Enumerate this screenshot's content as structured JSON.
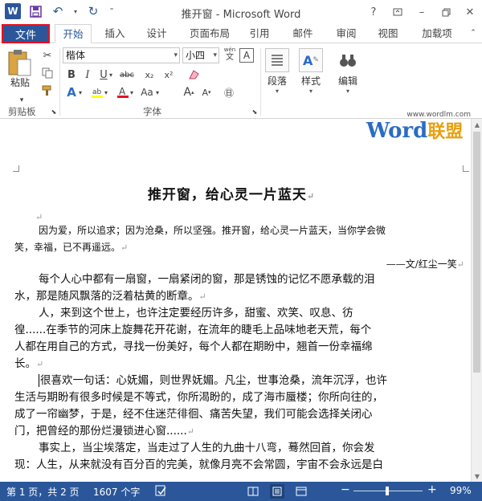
{
  "window": {
    "title": "推开窗 - Microsoft Word",
    "help": "?",
    "logo_letter": "W"
  },
  "tabs": {
    "file": "文件",
    "items": [
      "开始",
      "插入",
      "设计",
      "页面布局",
      "引用",
      "邮件",
      "审阅",
      "视图",
      "加载项"
    ]
  },
  "ribbon": {
    "clipboard": {
      "paste": "粘贴",
      "label": "剪贴板"
    },
    "font": {
      "family": "楷体",
      "size": "小四",
      "wen": "wén",
      "label": "字体",
      "bold": "B",
      "italic": "I",
      "underline": "U",
      "strike": "abc",
      "sub": "x₂",
      "sup": "x²",
      "a_letter": "A",
      "aa": "Aa"
    },
    "paragraph": {
      "label": "段落"
    },
    "styles": {
      "label": "样式"
    },
    "editing": {
      "label": "编辑"
    }
  },
  "watermark": {
    "url": "www.wordlm.com",
    "brand": "Word",
    "brand_cn": "联盟"
  },
  "document": {
    "title": "推开窗，给心灵一片蓝天",
    "lines": [
      "因为爱，所以追求；因为沧桑，所以坚强。推开窗，给心灵一片蓝天，当你学会微",
      "笑，幸福，已不再遥远。",
      "——文/红尘一笑",
      "每个人心中都有一扇窗，一扇紧闭的窗，那是锈蚀的记忆不愿承载的泪",
      "水，那是随风飘落的泛着枯黄的断章。",
      "人，来到这个世上，也许注定要经历许多，甜蜜、欢笑、叹息、彷",
      "徨......在季节的河床上旋舞花开花谢，在流年的睫毛上品味地老天荒，每个",
      "人都在用自己的方式，寻找一份美好，每个人都在期盼中，翘首一份幸福绵",
      "长。",
      "很喜欢一句话：心妩媚，则世界妩媚。凡尘，世事沧桑，流年沉浮，也许",
      "生活与期盼有很多时候是不等式，你所渴盼的，成了海市蜃楼；你所向往的，",
      "成了一帘幽梦，于是，经不住迷茫徘徊、痛苦失望，我们可能会选择关闭心",
      "门，把曾经的那份烂漫锁进心窗......",
      "事实上，当尘埃落定，当走过了人生的九曲十八弯，蓦然回首，你会发",
      "现：人生，从来就没有百分百的完美，就像月亮不会常圆，宇宙不会永远是白"
    ]
  },
  "status": {
    "page": "第 1 页，共 2 页",
    "words": "1607 个字",
    "zoom": "99%",
    "zoom_minus": "−",
    "zoom_plus": "+"
  },
  "colors": {
    "accent": "#2b579a",
    "highlight": "#e81123"
  }
}
